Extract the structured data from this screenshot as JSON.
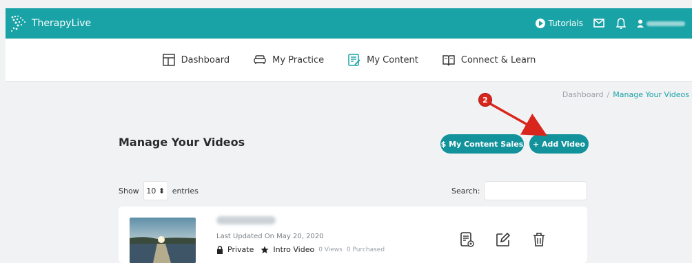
{
  "app": {
    "name": "TherapyLive"
  },
  "header": {
    "tutorials_label": "Tutorials"
  },
  "nav": {
    "items": [
      {
        "label": "Dashboard"
      },
      {
        "label": "My Practice"
      },
      {
        "label": "My Content"
      },
      {
        "label": "Connect & Learn"
      }
    ]
  },
  "breadcrumb": {
    "root": "Dashboard",
    "separator": "/",
    "current": "Manage Your Videos"
  },
  "page": {
    "title": "Manage Your Videos"
  },
  "buttons": {
    "content_sales": "$ My Content Sales",
    "add_video": "+ Add Video"
  },
  "table_controls": {
    "show_label": "Show",
    "entries_value": "10 ⬍",
    "entries_label": "entries",
    "search_label": "Search:"
  },
  "video": {
    "updated": "Last Updated On May 20, 2020",
    "privacy": "Private",
    "type": "Intro Video",
    "views": "0 Views",
    "purchased": "0 Purchased"
  },
  "annotation": {
    "step": "2"
  },
  "colors": {
    "brand": "#1aa3a7",
    "button": "#12929b",
    "annotation": "#d9261c"
  }
}
